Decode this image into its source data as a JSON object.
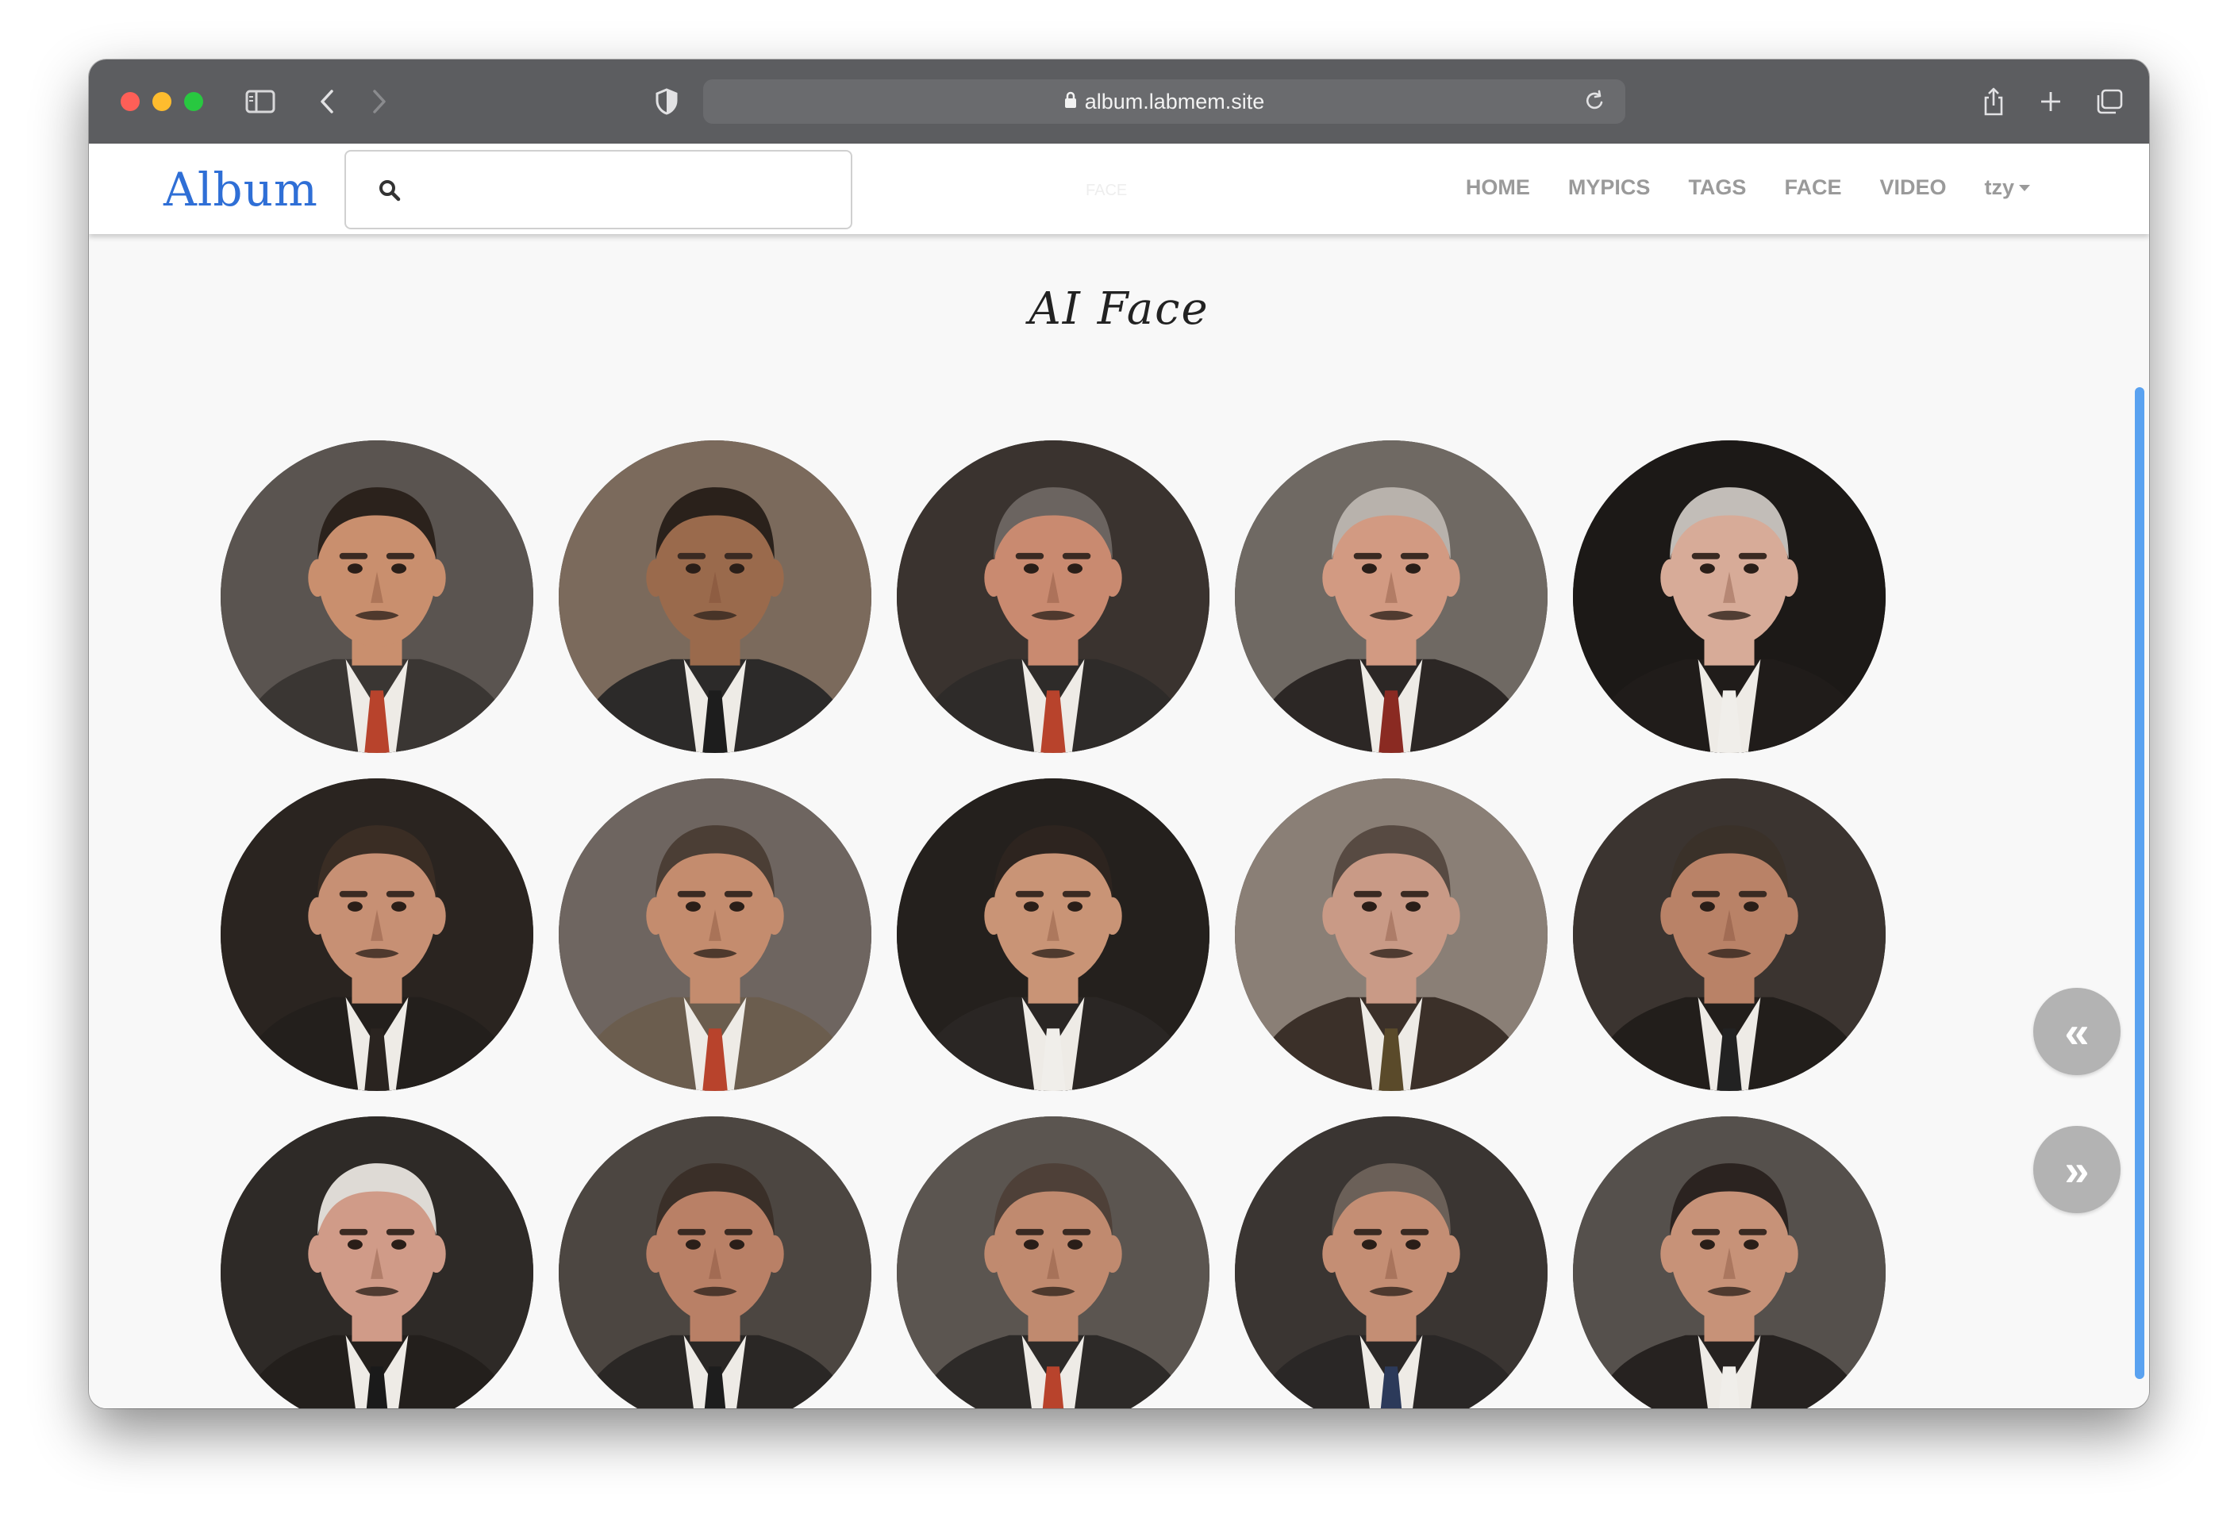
{
  "browser": {
    "url": "album.labmem.site"
  },
  "navbar": {
    "brand": "Album",
    "search_placeholder": "",
    "ghost_label": "FACE",
    "links": [
      {
        "label": "HOME"
      },
      {
        "label": "MYPICS"
      },
      {
        "label": "TAGS"
      },
      {
        "label": "FACE"
      },
      {
        "label": "VIDEO"
      }
    ],
    "user": "tzy"
  },
  "page": {
    "title": "AI Face"
  },
  "faces": [
    {
      "name": "face-1",
      "skin": "#c98f6e",
      "hair": "#2b221c",
      "suit": "#3a3633",
      "bg": "#5a5450",
      "tie": "#b8432c"
    },
    {
      "name": "face-2",
      "skin": "#9a6a4c",
      "hair": "#2a211b",
      "suit": "#2c2a29",
      "bg": "#7b6a5c",
      "tie": "#1d1d1d"
    },
    {
      "name": "face-3",
      "skin": "#c98a70",
      "hair": "#6b6460",
      "suit": "#2e2b29",
      "bg": "#3a332f",
      "tie": "#b8432c"
    },
    {
      "name": "face-4",
      "skin": "#d29a82",
      "hair": "#b8b2ac",
      "suit": "#2c2725",
      "bg": "#6f6963",
      "tie": "#8a2a22"
    },
    {
      "name": "face-5",
      "skin": "#d7ab98",
      "hair": "#c2bdb8",
      "suit": "#201c1a",
      "bg": "#1c1917",
      "tie": "#f0eeea"
    },
    {
      "name": "face-6",
      "skin": "#c79074",
      "hair": "#3a2d24",
      "suit": "#231f1c",
      "bg": "#2a2420",
      "tie": "#2a2420"
    },
    {
      "name": "face-7",
      "skin": "#c48c6e",
      "hair": "#4b3e35",
      "suit": "#6b5d4e",
      "bg": "#6e6560",
      "tie": "#b8432c"
    },
    {
      "name": "face-8",
      "skin": "#c99476",
      "hair": "#2d241f",
      "suit": "#2a2624",
      "bg": "#24201d",
      "tie": "#f0eeea"
    },
    {
      "name": "face-9",
      "skin": "#c99a86",
      "hair": "#574a42",
      "suit": "#3b3029",
      "bg": "#8a7f76",
      "tie": "#5a4a2a"
    },
    {
      "name": "face-10",
      "skin": "#b98267",
      "hair": "#3a3129",
      "suit": "#221e1b",
      "bg": "#3b3430",
      "tie": "#222"
    },
    {
      "name": "face-11",
      "skin": "#d09b88",
      "hair": "#dedad5",
      "suit": "#231f1c",
      "bg": "#2e2a27",
      "tie": "#1a1a1a"
    },
    {
      "name": "face-12",
      "skin": "#b98066",
      "hair": "#3a2f28",
      "suit": "#2a2725",
      "bg": "#4c4641",
      "tie": "#1d1d1d"
    },
    {
      "name": "face-13",
      "skin": "#c08a6f",
      "hair": "#4e4038",
      "suit": "#2d2a28",
      "bg": "#5b5550",
      "tie": "#b8432c"
    },
    {
      "name": "face-14",
      "skin": "#c48e74",
      "hair": "#6b6058",
      "suit": "#2a2726",
      "bg": "#3a3532",
      "tie": "#2c3a5a"
    },
    {
      "name": "face-15",
      "skin": "#c79278",
      "hair": "#2b2320",
      "suit": "#262220",
      "bg": "#55504c",
      "tie": "#f0eeea"
    }
  ],
  "buttons": {
    "prev": "«",
    "next": "»"
  },
  "colors": {
    "brand": "#2f6fd6",
    "nav_link": "#9a9a9a",
    "scrollbar": "#5aa2f0",
    "fab": "#b3b3b3"
  }
}
